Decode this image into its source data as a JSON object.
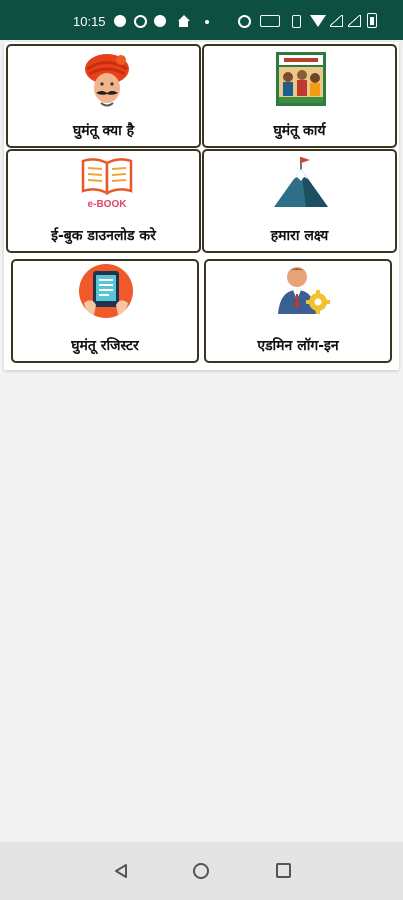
{
  "status_bar": {
    "time": "10:15",
    "icons": [
      "message-icon",
      "whatsapp-icon",
      "flipboard-icon",
      "home-app-icon",
      "dot-icon",
      "alarm-icon",
      "data-icon",
      "vibrate-icon",
      "wifi-icon",
      "signal-icon",
      "signal-icon",
      "battery-icon"
    ],
    "background": "#0d4f41"
  },
  "menu": {
    "items": [
      {
        "label": "घुमंतू क्या है",
        "icon": "turban-man-icon"
      },
      {
        "label": "घुमंतू कार्य",
        "icon": "activity-poster-icon"
      },
      {
        "label": "ई-बुक डाउनलोड करे",
        "icon": "ebook-icon"
      },
      {
        "label": "हमारा लक्ष्य",
        "icon": "mountain-flag-icon"
      },
      {
        "label": "घुमंतू रजिस्टर",
        "icon": "tablet-register-icon"
      },
      {
        "label": "एडमिन लॉग-इन",
        "icon": "admin-gear-icon"
      }
    ],
    "ebook_icon_text": "e-BOOK"
  },
  "nav_bar": {
    "buttons": [
      "back-icon",
      "home-icon",
      "recent-apps-icon"
    ]
  }
}
